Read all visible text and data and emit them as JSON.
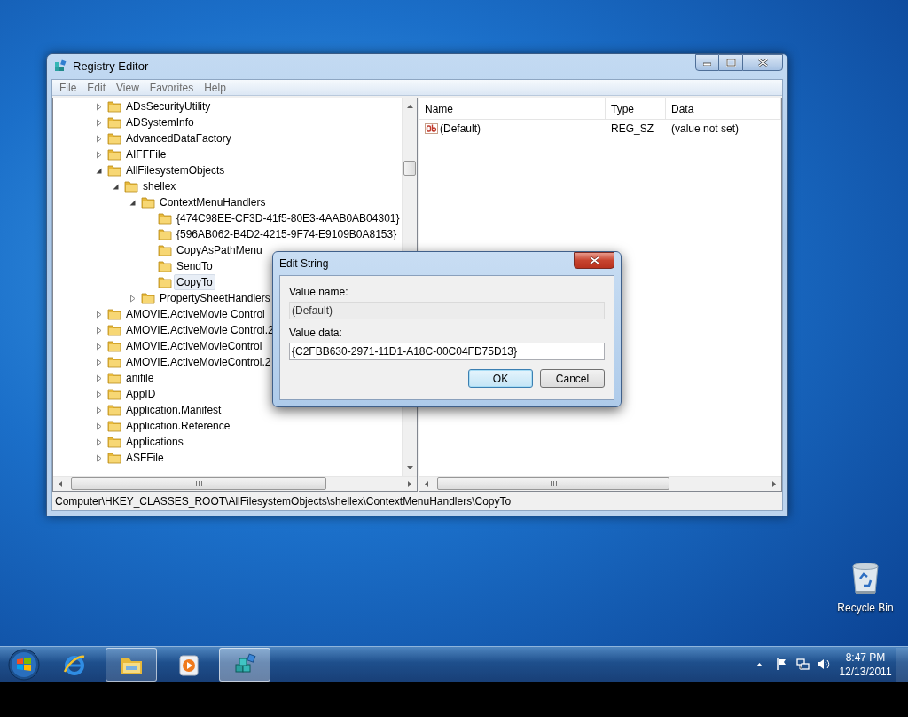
{
  "window": {
    "title": "Registry Editor",
    "menu": [
      "File",
      "Edit",
      "View",
      "Favorites",
      "Help"
    ],
    "tree": [
      {
        "label": "ADsSecurityUtility",
        "kind": "branch",
        "expanded": false,
        "selected": false
      },
      {
        "label": "ADSystemInfo",
        "kind": "branch",
        "expanded": false,
        "selected": false
      },
      {
        "label": "AdvancedDataFactory",
        "kind": "branch",
        "expanded": false,
        "selected": false
      },
      {
        "label": "AIFFFile",
        "kind": "branch",
        "expanded": false,
        "selected": false
      },
      {
        "label": "AllFilesystemObjects",
        "kind": "branch",
        "expanded": true,
        "selected": false,
        "children": [
          {
            "label": "shellex",
            "kind": "branch",
            "expanded": true,
            "selected": false,
            "children": [
              {
                "label": "ContextMenuHandlers",
                "kind": "branch",
                "expanded": true,
                "selected": false,
                "children": [
                  {
                    "label": "{474C98EE-CF3D-41f5-80E3-4AAB0AB04301}",
                    "selected": false
                  },
                  {
                    "label": "{596AB062-B4D2-4215-9F74-E9109B0A8153}",
                    "selected": false
                  },
                  {
                    "label": "CopyAsPathMenu",
                    "selected": false
                  },
                  {
                    "label": "SendTo",
                    "selected": false
                  },
                  {
                    "label": "CopyTo",
                    "selected": true
                  }
                ]
              },
              {
                "label": "PropertySheetHandlers",
                "kind": "branch",
                "expanded": false,
                "selected": false
              }
            ]
          }
        ]
      },
      {
        "label": "AMOVIE.ActiveMovie Control",
        "kind": "branch",
        "expanded": false,
        "selected": false
      },
      {
        "label": "AMOVIE.ActiveMovie Control.2",
        "kind": "branch",
        "expanded": false,
        "selected": false
      },
      {
        "label": "AMOVIE.ActiveMovieControl",
        "kind": "branch",
        "expanded": false,
        "selected": false
      },
      {
        "label": "AMOVIE.ActiveMovieControl.2",
        "kind": "branch",
        "expanded": false,
        "selected": false
      },
      {
        "label": "anifile",
        "kind": "branch",
        "expanded": false,
        "selected": false
      },
      {
        "label": "AppID",
        "kind": "branch",
        "expanded": false,
        "selected": false
      },
      {
        "label": "Application.Manifest",
        "kind": "branch",
        "expanded": false,
        "selected": false
      },
      {
        "label": "Application.Reference",
        "kind": "branch",
        "expanded": false,
        "selected": false
      },
      {
        "label": "Applications",
        "kind": "branch",
        "expanded": false,
        "selected": false
      },
      {
        "label": "ASFFile",
        "kind": "branch",
        "expanded": false,
        "selected": false
      }
    ],
    "values_table": {
      "columns": [
        "Name",
        "Type",
        "Data"
      ],
      "rows": [
        {
          "name": "(Default)",
          "type": "REG_SZ",
          "data": "(value not set)"
        }
      ]
    },
    "status_bar": "Computer\\HKEY_CLASSES_ROOT\\AllFilesystemObjects\\shellex\\ContextMenuHandlers\\CopyTo"
  },
  "dialog": {
    "title": "Edit String",
    "value_name_label": "Value name:",
    "value_name": "(Default)",
    "value_data_label": "Value data:",
    "value_data": "{C2FBB630-2971-11D1-A18C-00C04FD75D13}",
    "buttons": [
      {
        "label": "OK",
        "default": true
      },
      {
        "label": "Cancel",
        "default": false
      }
    ]
  },
  "desktop_icons": [
    {
      "label": "Recycle Bin"
    }
  ],
  "taskbar": {
    "apps": [
      {
        "kind": "browser",
        "running": false,
        "selected": false
      },
      {
        "kind": "explorer",
        "running": true,
        "selected": false
      },
      {
        "kind": "media",
        "running": false,
        "selected": false
      },
      {
        "kind": "regedit",
        "running": true,
        "selected": true
      }
    ],
    "clock": {
      "time": "8:47 PM",
      "date": "12/13/2011"
    }
  }
}
